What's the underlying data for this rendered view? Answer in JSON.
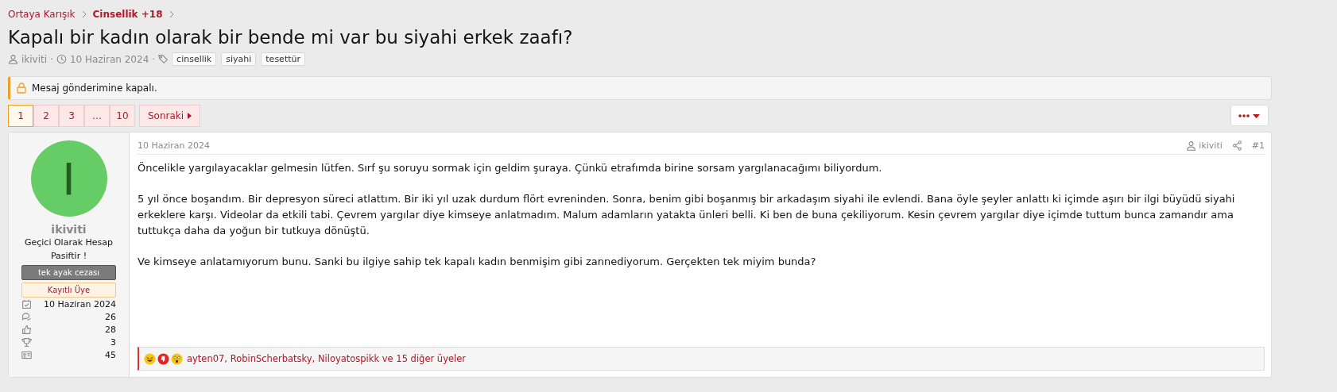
{
  "breadcrumbs": [
    {
      "label": "Ortaya Karışık",
      "current": false
    },
    {
      "label": "Cinsellik +18",
      "current": true
    }
  ],
  "thread": {
    "separator": "·",
    "title": "Kapalı bir kadın olarak bir bende mi var bu siyahi erkek zaafı?",
    "author": "ikiviti",
    "date": "10 Haziran 2024",
    "tags": [
      "cinsellik",
      "siyahi",
      "tesettür"
    ]
  },
  "notice": "Mesaj gönderimine kapalı.",
  "pagination": {
    "pages": [
      {
        "label": "1",
        "selected": true
      },
      {
        "label": "2",
        "selected": false
      },
      {
        "label": "3",
        "selected": false
      },
      {
        "label": "…",
        "selected": false
      },
      {
        "label": "10",
        "selected": false
      }
    ],
    "next": "Sonraki"
  },
  "post": {
    "user": {
      "avatar_letter": "I",
      "name": "ikiviti",
      "title": "Geçici Olarak Hesap Pasiftir !",
      "banners": [
        {
          "label": "tek ayak cezası",
          "kind": "dark"
        },
        {
          "label": "Kayıtlı Üye",
          "kind": "light"
        }
      ],
      "stats": [
        {
          "kind": "joined",
          "value": "10 Haziran 2024"
        },
        {
          "kind": "messages",
          "value": "26"
        },
        {
          "kind": "reactions",
          "value": "28"
        },
        {
          "kind": "points",
          "value": "3"
        },
        {
          "kind": "card",
          "value": "45"
        }
      ]
    },
    "date": "10 Haziran 2024",
    "author": "ikiviti",
    "number": "#1",
    "paragraphs": [
      "Öncelikle yargılayacaklar gelmesin lütfen. Sırf şu soruyu sormak için geldim şuraya. Çünkü etrafımda birine sorsam yargılanacağımı biliyordum.",
      "5 yıl önce boşandım. Bir depresyon süreci atlattım. Bir iki yıl uzak durdum flört evreninden. Sonra, benim gibi boşanmış bir arkadaşım siyahi ile evlendi. Bana öyle şeyler anlattı ki içimde aşırı bir ilgi büyüdü siyahi erkeklere karşı. Videolar da etkili tabi. Çevrem yargılar diye kimseye anlatmadım. Malum adamların yatakta ünleri belli. Ki ben de buna çekiliyorum. Kesin çevrem yargılar diye içimde tuttum bunca zamandır ama tuttukça daha da yoğun bir tutkuya dönüştü.",
      "Ve kimseye anlatamıyorum bunu. Sanki bu ilgiye sahip tek kapalı kadın benmişim gibi zannediyorum. Gerçekten tek miyim bunda?"
    ],
    "reactions": {
      "emojis": [
        {
          "kind": "laugh"
        },
        {
          "kind": "dislike"
        },
        {
          "kind": "wow"
        }
      ],
      "text": "ayten07, RobinScherbatsky, Niloyatospikk ve 15 diğer üyeler"
    }
  }
}
